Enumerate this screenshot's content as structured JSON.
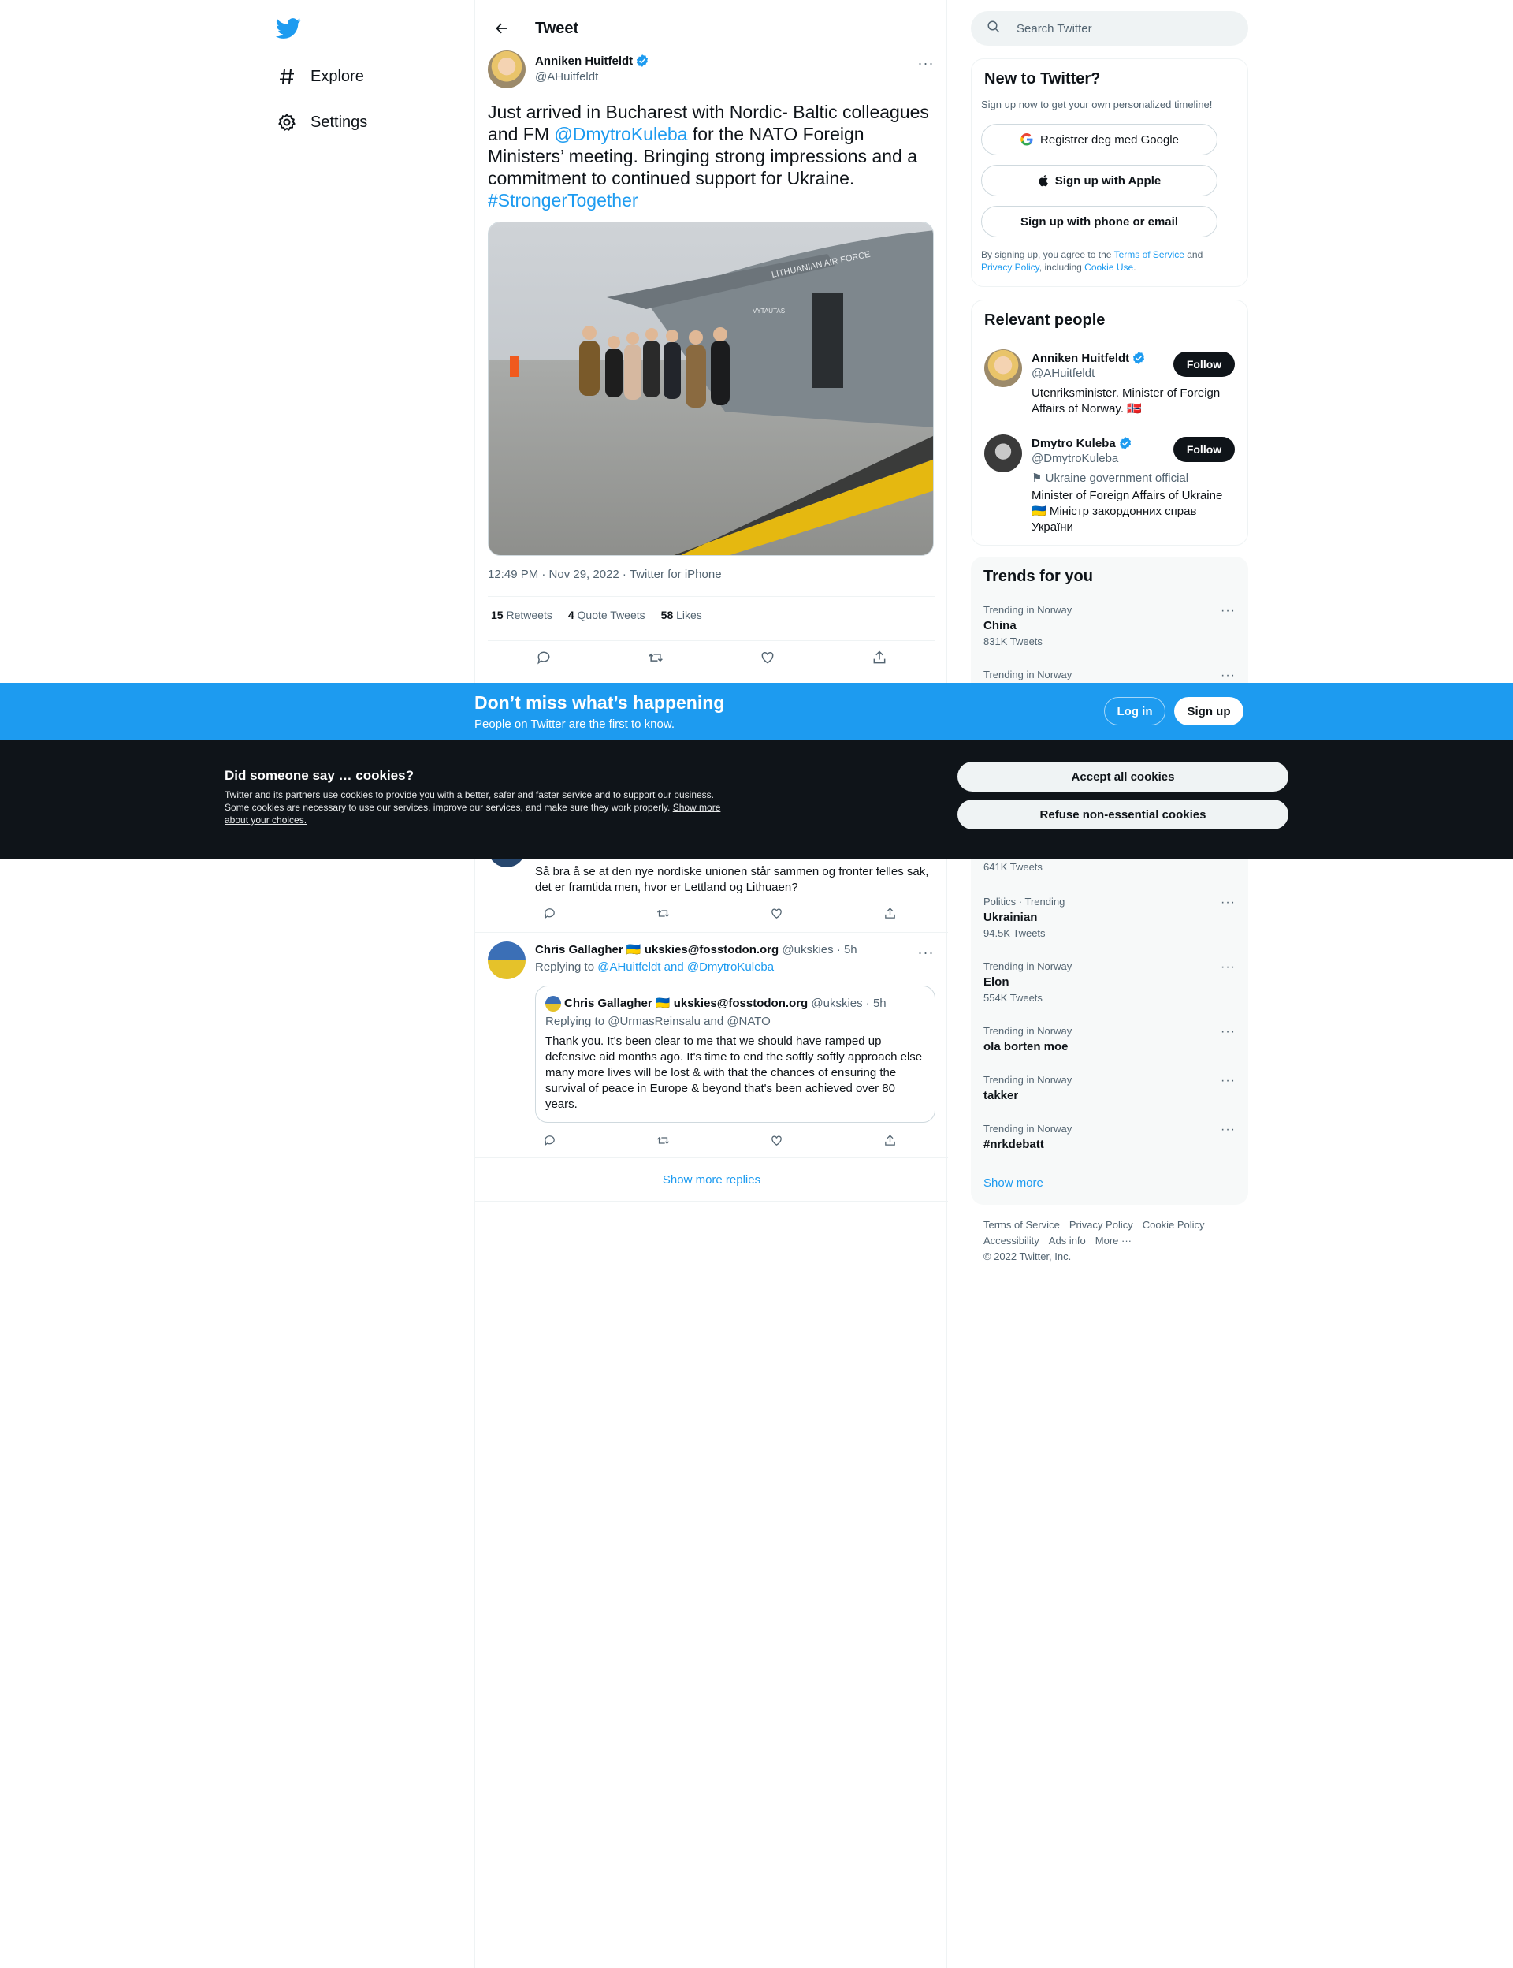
{
  "nav": {
    "items": [
      {
        "label": "Explore",
        "icon": "hashtag-icon"
      },
      {
        "label": "Settings",
        "icon": "gear-icon"
      }
    ]
  },
  "header": {
    "title": "Tweet"
  },
  "tweet": {
    "author_name": "Anniken Huitfeldt",
    "author_handle": "@AHuitfeldt",
    "text_1": "Just arrived in Bucharest with Nordic- Baltic colleagues and FM ",
    "mention": "@DmytroKuleba",
    "text_2": " for the NATO Foreign Ministers’ meeting. Bringing strong impressions and a commitment to continued support for Ukraine.",
    "hashtag": "#StrongerTogether",
    "image_plane_text": "LITHUANIAN AIR FORCE",
    "image_plane_name": "VYTAUTAS",
    "meta": "12:49 PM · Nov 29, 2022 · Twitter for iPhone",
    "retweets": "15",
    "retweets_label": "Retweets",
    "quotes": "4",
    "quotes_label": "Quote Tweets",
    "likes": "58",
    "likes_label": "Likes"
  },
  "replies": {
    "first_text": "Så bra å se at den nye nordiske unionen står sammen og fronter felles sak, det er framtida men, hvor er Lettland og Lithuaen?",
    "second": {
      "name": "Chris Gallagher 🇺🇦 ukskies@fosstodon.org",
      "handle": "@ukskies",
      "time": "· 5h",
      "replying_prefix": "Replying to ",
      "replying_to": "@AHuitfeldt and @DmytroKuleba",
      "quote": {
        "name": "Chris Gallagher 🇺🇦 ukskies@fosstodon.org",
        "handle": "@ukskies",
        "time": "· 5h",
        "replying": "Replying to @UrmasReinsalu and @NATO",
        "text": "Thank you. It's been clear to me that we should have ramped up defensive aid months ago. It's time to end the softly softly approach else many more lives will be lost & with that the chances of ensuring the survival of peace in Europe & beyond that's been achieved over 80 years."
      }
    },
    "show_more": "Show more replies"
  },
  "sidebar": {
    "search_placeholder": "Search Twitter",
    "new_to_twitter": {
      "title": "New to Twitter?",
      "subtitle": "Sign up now to get your own personalized timeline!",
      "google": "Registrer deg med Google",
      "apple": "Sign up with Apple",
      "phone": "Sign up with phone or email",
      "legal_1": "By signing up, you agree to the ",
      "terms": "Terms of Service",
      "legal_2": " and ",
      "privacy": "Privacy Policy",
      "legal_3": ", including ",
      "cookie": "Cookie Use",
      "legal_4": "."
    },
    "relevant": {
      "title": "Relevant people",
      "people": [
        {
          "name": "Anniken Huitfeldt",
          "handle": "@AHuitfeldt",
          "bio": "Utenriksminister. Minister of Foreign Affairs of Norway. 🇳🇴",
          "follow": "Follow"
        },
        {
          "name": "Dmytro Kuleba",
          "handle": "@DmytroKuleba",
          "label": "⚑ Ukraine government official",
          "bio": "Minister of Foreign Affairs of Ukraine 🇺🇦 Міністр закордонних справ України",
          "follow": "Follow"
        }
      ]
    },
    "trends": {
      "title": "Trends for you",
      "items": [
        {
          "context": "Trending in Norway",
          "name": "China",
          "count": "831K Tweets"
        },
        {
          "context": "Trending in Norway",
          "name": "",
          "count": ""
        },
        {
          "context": "",
          "name": "",
          "count": "641K Tweets"
        },
        {
          "context": "Politics · Trending",
          "name": "Ukrainian",
          "count": "94.5K Tweets"
        },
        {
          "context": "Trending in Norway",
          "name": "Elon",
          "count": "554K Tweets"
        },
        {
          "context": "Trending in Norway",
          "name": "ola borten moe",
          "count": ""
        },
        {
          "context": "Trending in Norway",
          "name": "takker",
          "count": ""
        },
        {
          "context": "Trending in Norway",
          "name": "#nrkdebatt",
          "count": ""
        }
      ],
      "show_more": "Show more"
    },
    "footer": {
      "links": [
        "Terms of Service",
        "Privacy Policy",
        "Cookie Policy",
        "Accessibility",
        "Ads info",
        "More ···"
      ],
      "copyright": "© 2022 Twitter, Inc."
    }
  },
  "banner": {
    "title": "Don’t miss what’s happening",
    "subtitle": "People on Twitter are the first to know.",
    "login": "Log in",
    "signup": "Sign up"
  },
  "cookies": {
    "title": "Did someone say … cookies?",
    "description": "Twitter and its partners use cookies to provide you with a better, safer and faster service and to support our business. Some cookies are necessary to use our services, improve our services, and make sure they work properly. ",
    "link": "Show more about your choices.",
    "accept": "Accept all cookies",
    "refuse": "Refuse non-essential cookies"
  },
  "colors": {
    "accent": "#1d9bf0",
    "dark": "#0f1419",
    "muted": "#536471",
    "border": "#eff3f4"
  }
}
